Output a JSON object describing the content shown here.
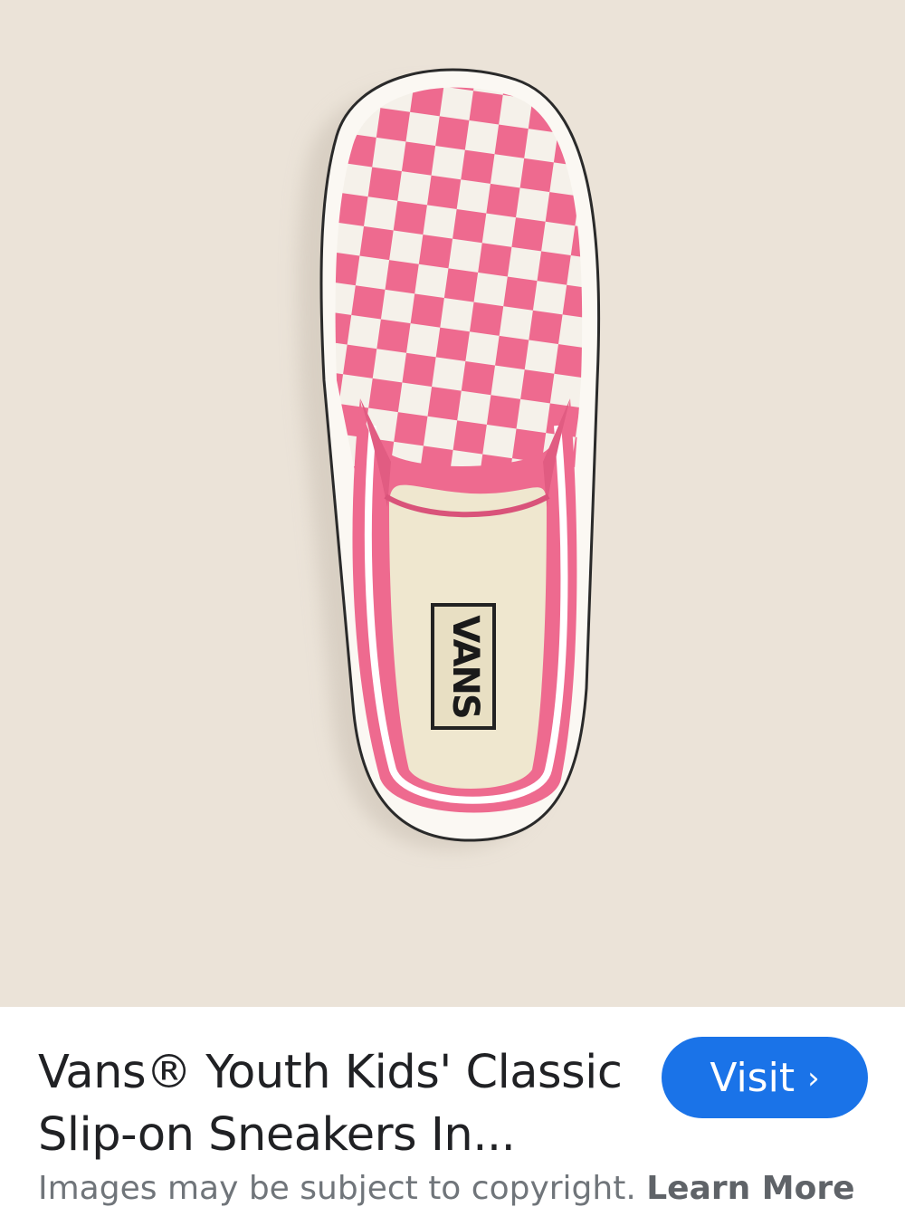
{
  "result": {
    "title_line1": "Vans® Youth Kids' Classic",
    "title_line2": "Slip-on Sneakers In...",
    "visit_label": "Visit",
    "visit_chevron": "›",
    "copyright_text": "Images may be subject to copyright.",
    "learn_more_label": "Learn More",
    "brand_logo_text": "VANS"
  },
  "colors": {
    "background": "#ebe3d8",
    "shoe_pink": "#ee6a8f",
    "accent_button": "#1a73e8"
  }
}
